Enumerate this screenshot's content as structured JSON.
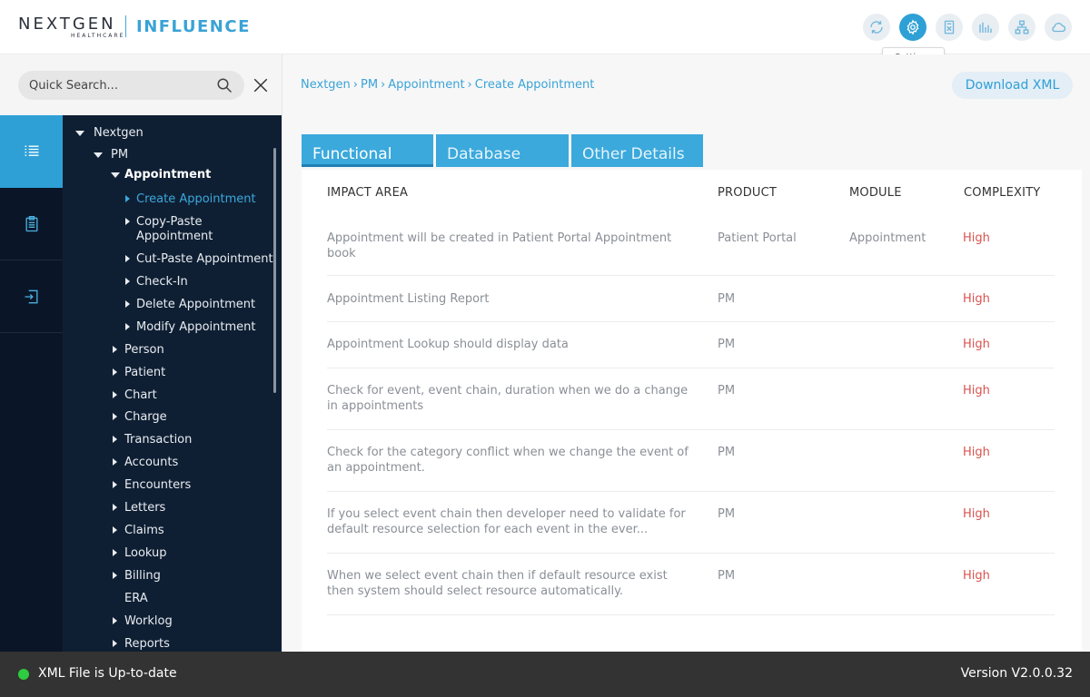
{
  "header": {
    "logo_main": "NEXTGEN",
    "logo_sub": "HEALTHCARE",
    "product": "INFLUENCE",
    "icons": [
      "refresh-icon",
      "settings-icon",
      "calculator-icon",
      "chart-bars-icon",
      "hierarchy-icon",
      "cloud-icon"
    ],
    "tooltip": "Settings"
  },
  "search": {
    "placeholder": "Quick Search..."
  },
  "rail": {
    "items": [
      "list-icon",
      "clipboard-icon",
      "login-icon"
    ]
  },
  "tree": {
    "nextgen": "Nextgen",
    "pm": "PM",
    "appointment": "Appointment",
    "children": [
      "Create Appointment",
      "Copy-Paste Appointment",
      "Cut-Paste Appointment",
      "Check-In",
      "Delete Appointment",
      "Modify Appointment"
    ],
    "siblings": [
      "Person",
      "Patient",
      "Chart",
      "Charge",
      "Transaction",
      "Accounts",
      "Encounters",
      "Letters",
      "Claims",
      "Lookup",
      "Billing",
      "ERA",
      "Worklog",
      "Reports"
    ]
  },
  "breadcrumb": [
    "Nextgen",
    "PM",
    "Appointment",
    "Create Appointment"
  ],
  "download_label": "Download XML",
  "tabs": [
    "Functional",
    "Database",
    "Other Details"
  ],
  "table": {
    "headers": [
      "IMPACT AREA",
      "PRODUCT",
      "MODULE",
      "COMPLEXITY"
    ],
    "rows": [
      {
        "impact": "Appointment will be created in Patient Portal Appointment book",
        "product": "Patient Portal",
        "module": "Appointment",
        "complexity": "High"
      },
      {
        "impact": "Appointment Listing Report",
        "product": "PM",
        "module": "",
        "complexity": "High"
      },
      {
        "impact": "Appointment Lookup should display data",
        "product": "PM",
        "module": "",
        "complexity": "High"
      },
      {
        "impact": "Check for event, event chain, duration when we do a change in  appointments",
        "product": "PM",
        "module": "",
        "complexity": "High"
      },
      {
        "impact": "Check for the category conflict when we change the event of an appointment.",
        "product": "PM",
        "module": "",
        "complexity": "High"
      },
      {
        "impact": "If you select event chain then developer need to validate for default resource selection for each event in the ever...",
        "product": "PM",
        "module": "",
        "complexity": "High"
      },
      {
        "impact": "When we select event chain then if default resource exist then system should select resource automatically.",
        "product": "PM",
        "module": "",
        "complexity": "High"
      }
    ]
  },
  "footer": {
    "status": "XML File is Up-to-date",
    "version": "Version V2.0.0.32"
  }
}
